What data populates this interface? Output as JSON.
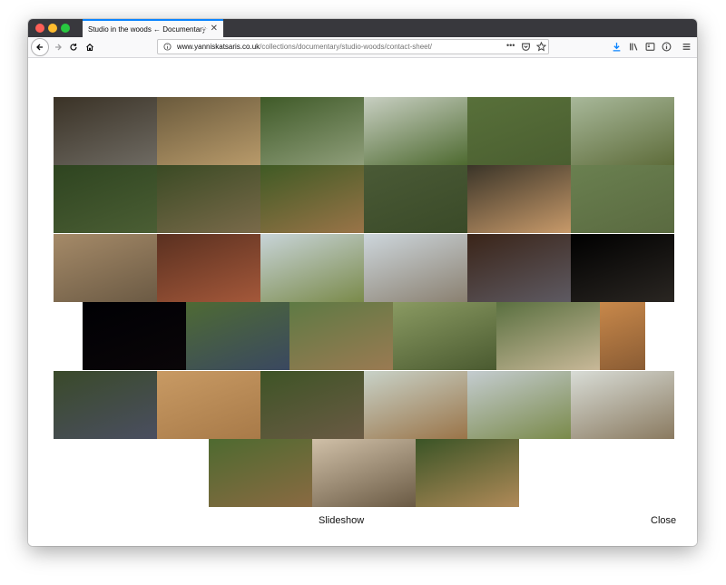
{
  "browser": {
    "tab_title": "Studio in the woods ← Documentary",
    "tab_close": "✕",
    "new_tab": "+",
    "url_domain": "www.yanniskatsaris.co.uk",
    "url_path": "/collections/documentary/studio-woods/contact-sheet/",
    "page_actions": "•••"
  },
  "footer": {
    "slideshow_label": "Slideshow",
    "close_label": "Close"
  },
  "photos": [
    {
      "top": "#3a3226",
      "bottom": "#6e6a62"
    },
    {
      "top": "#6a5a3c",
      "bottom": "#b89a6a"
    },
    {
      "top": "#3f5a28",
      "bottom": "#8f9e7a"
    },
    {
      "top": "#c8cfc2",
      "bottom": "#4e6a30"
    },
    {
      "top": "#58703a",
      "bottom": "#4a5e30"
    },
    {
      "top": "#a8b89a",
      "bottom": "#5e6c3a"
    },
    {
      "top": "#2e4420",
      "bottom": "#4b5e34"
    },
    {
      "top": "#3a4a24",
      "bottom": "#7a6a4a"
    },
    {
      "top": "#3f5a24",
      "bottom": "#9a7448"
    },
    {
      "top": "#4a5a36",
      "bottom": "#3a4a28"
    },
    {
      "top": "#3a3428",
      "bottom": "#c89a6a"
    },
    {
      "top": "#6a8050",
      "bottom": "#5a6a40"
    },
    {
      "top": "#a58a68",
      "bottom": "#6b5a44"
    },
    {
      "top": "#5a3020",
      "bottom": "#a4583a"
    },
    {
      "top": "#c8d4d8",
      "bottom": "#7a8a4a"
    },
    {
      "top": "#cdd6dc",
      "bottom": "#8a8070"
    },
    {
      "top": "#3a2418",
      "bottom": "#5e5a62"
    },
    {
      "top": "#000000",
      "bottom": "#2a2622"
    },
    {
      "top": "#000004",
      "bottom": "#0a0608"
    },
    {
      "top": "#4e6a34",
      "bottom": "#3a4860"
    },
    {
      "top": "#5e7a44",
      "bottom": "#9a7a52"
    },
    {
      "top": "#8a9a62",
      "bottom": "#4a5a30"
    },
    {
      "top": "#5a7040",
      "bottom": "#c8b898"
    },
    {
      "top": "#c8884a",
      "bottom": "#8a5c34"
    },
    {
      "top": "#3a4a2a",
      "bottom": "#4a4e60"
    },
    {
      "top": "#c89a64",
      "bottom": "#a87a48"
    },
    {
      "top": "#3e5426",
      "bottom": "#6a5a44"
    },
    {
      "top": "#c8d2c8",
      "bottom": "#9a7448"
    },
    {
      "top": "#c4ccd0",
      "bottom": "#7a8a4a"
    },
    {
      "top": "#d8dcd6",
      "bottom": "#8a7a60"
    },
    {
      "top": "#4e6a30",
      "bottom": "#8a6a42"
    },
    {
      "top": "#d0c0a8",
      "bottom": "#6a5a44"
    },
    {
      "top": "#3a5426",
      "bottom": "#b08a58"
    },
    {
      "top": "#2e4420",
      "bottom": "#4a4a36"
    }
  ]
}
